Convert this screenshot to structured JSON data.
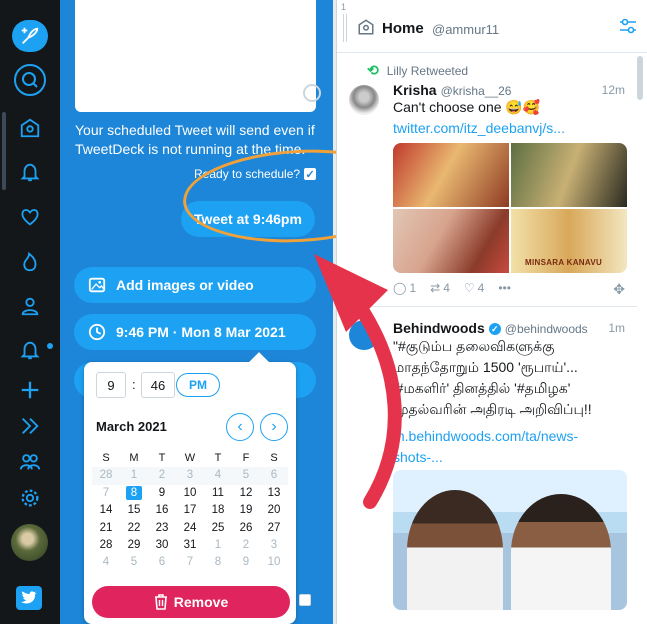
{
  "nav": {
    "items": [
      "compose-icon",
      "search-icon",
      "home-icon",
      "notifications-icon",
      "likes-icon",
      "trending-icon",
      "profile-icon",
      "activity-icon",
      "add-column-icon",
      "collapse-icon",
      "accounts-icon",
      "settings-icon",
      "avatar",
      "tweetdeck-logo"
    ]
  },
  "compose": {
    "schedule_note": "Your scheduled Tweet will send even if TweetDeck is not running at the time.",
    "ready_label": "Ready to schedule?",
    "tweet_button": "Tweet at 9:46pm",
    "add_media": "Add images or video",
    "schedule_button": "9:46 PM · Mon 8 Mar 2021"
  },
  "picker": {
    "hour": "9",
    "colon": ":",
    "minute": "46",
    "ampm": "PM",
    "month": "March 2021",
    "weekdays": [
      "S",
      "M",
      "T",
      "W",
      "T",
      "F",
      "S"
    ],
    "weeks": [
      [
        "28",
        "1",
        "2",
        "3",
        "4",
        "5",
        "6"
      ],
      [
        "7",
        "8",
        "9",
        "10",
        "11",
        "12",
        "13"
      ],
      [
        "14",
        "15",
        "16",
        "17",
        "18",
        "19",
        "20"
      ],
      [
        "21",
        "22",
        "23",
        "24",
        "25",
        "26",
        "27"
      ],
      [
        "28",
        "29",
        "30",
        "31",
        "1",
        "2",
        "3"
      ],
      [
        "4",
        "5",
        "6",
        "7",
        "8",
        "9",
        "10"
      ]
    ],
    "selected": "8",
    "remove": "Remove"
  },
  "column": {
    "number": "1",
    "title": "Home",
    "handle": "@ammur11"
  },
  "tweet1": {
    "retweeted_by": "Lilly Retweeted",
    "name": "Krisha",
    "handle": "@krisha__26",
    "time": "12m",
    "text": "Can't choose one 😅🥰",
    "link": "twitter.com/itz_deebanvj/s...",
    "media_caption": "MINSARA KANAVU",
    "replies": "1",
    "retweets": "4",
    "likes": "4"
  },
  "tweet2": {
    "name": "Behindwoods",
    "handle": "@behindwoods",
    "time": "1m",
    "text": "\"#குடும்ப தலைவிகளுக்கு மாதந்தோறும் 1500 'ரூபாய்'... '#மகளிர்' தினத்தில் '#தமிழக' முதல்வரின் அதிரடி அறிவிப்பு!!",
    "link": "m.behindwoods.com/ta/news-shots-..."
  },
  "colors": {
    "accent": "#1da1f2",
    "compose_bg": "#1d86d8",
    "nav_bg": "#14171a",
    "remove": "#e0245e",
    "annotation_oval": "#f0a13a",
    "annotation_arrow": "#e5334b"
  }
}
